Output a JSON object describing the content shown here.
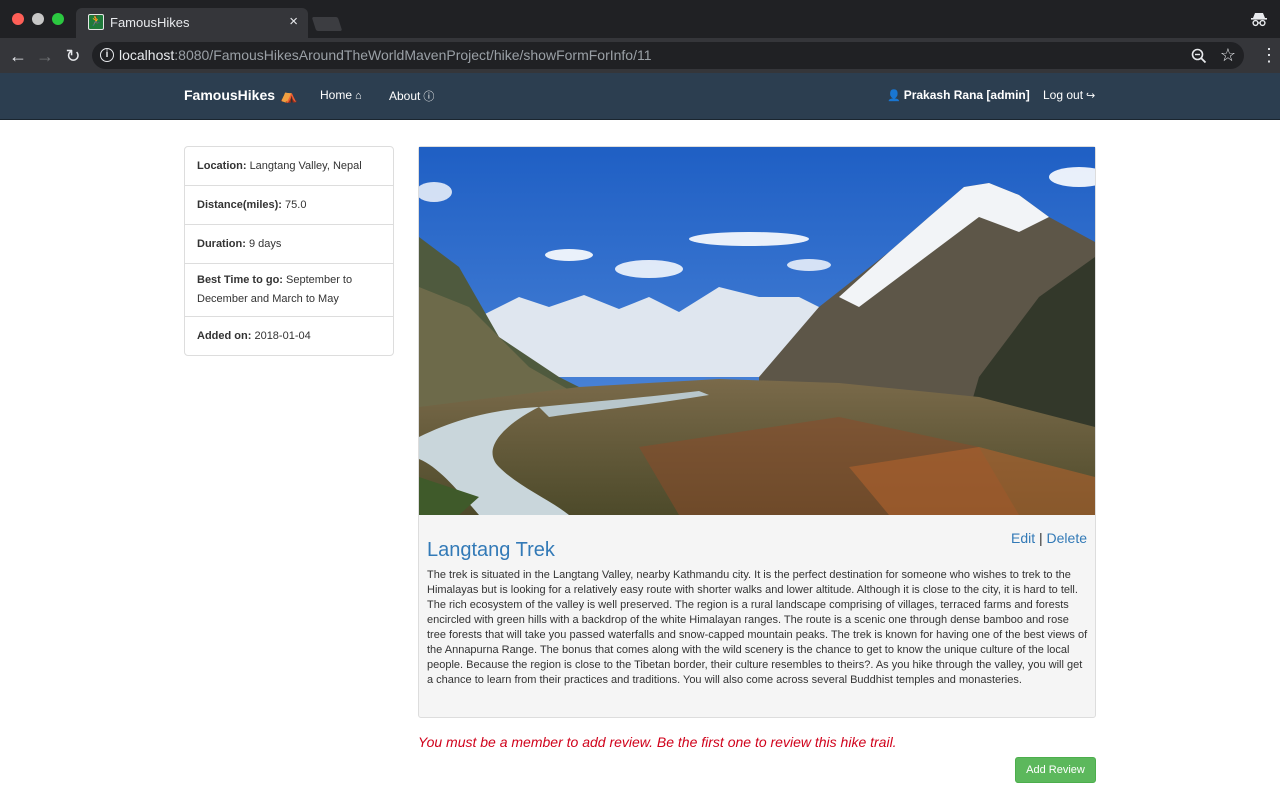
{
  "browser": {
    "tab_title": "FamousHikes",
    "url_host": "localhost",
    "url_rest": ":8080/FamousHikesAroundTheWorldMavenProject/hike/showFormForInfo/11"
  },
  "navbar": {
    "brand": "FamousHikes",
    "home": "Home",
    "about": "About",
    "user": "Prakash Rana [admin]",
    "logout": "Log out"
  },
  "info": {
    "location_label": "Location:",
    "location": "Langtang Valley, Nepal",
    "distance_label": "Distance(miles):",
    "distance": "75.0",
    "duration_label": "Duration:",
    "duration": "9 days",
    "best_time_label": "Best Time to go:",
    "best_time": "September to December and March to May",
    "added_label": "Added on:",
    "added": "2018-01-04"
  },
  "hike": {
    "title": "Langtang Trek",
    "edit": "Edit",
    "separator": "|",
    "delete": "Delete",
    "description": "The trek is situated in the Langtang Valley, nearby Kathmandu city. It is the perfect destination for someone who wishes to trek to the Himalayas but is looking for a relatively easy route with shorter walks and lower altitude. Although it is close to the city, it is hard to tell. The rich ecosystem of the valley is well preserved. The region is a rural landscape comprising of villages, terraced farms and forests encircled with green hills with a backdrop of the white Himalayan ranges. The route is a scenic one through dense bamboo and rose tree forests that will take you passed waterfalls and snow-capped mountain peaks. The trek is known for having one of the best views of the Annapurna Range. The bonus that comes along with the wild scenery is the chance to get to know the unique culture of the local people. Because the region is close to the Tibetan border, their culture resembles to theirs?. As you hike through the valley, you will get a chance to learn from their practices and traditions. You will also come across several Buddhist temples and monasteries."
  },
  "review": {
    "message": "You must be a member to add review. Be the first one to review this hike trail.",
    "button": "Add Review"
  },
  "colors": {
    "navbar_bg": "#2c3e50",
    "link": "#337ab7",
    "error": "#d0021b",
    "success": "#5cb85c"
  },
  "icons": {
    "brand": "tent-icon",
    "home": "home-icon",
    "about": "info-circle-icon",
    "user": "user-icon",
    "logout": "logout-icon"
  }
}
